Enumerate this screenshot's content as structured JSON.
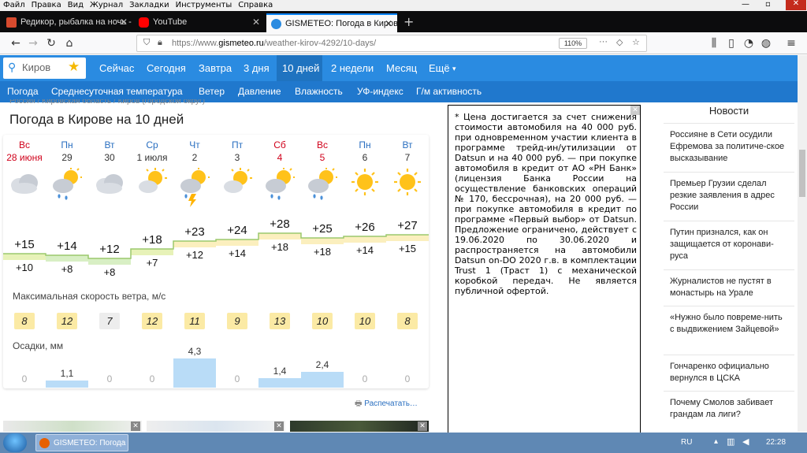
{
  "menu": [
    "Файл",
    "Правка",
    "Вид",
    "Журнал",
    "Закладки",
    "Инструменты",
    "Справка"
  ],
  "tabs": [
    {
      "title": "Редикор, рыбалка на ночь - Р",
      "color": "#d64a2e"
    },
    {
      "title": "YouTube",
      "color": "#ff0000"
    },
    {
      "title": "GISMETEO: Погода в Кирове н",
      "color": "#2a8be1"
    }
  ],
  "url_prefix": "https://www.",
  "url_domain": "gismeteo.ru",
  "url_path": "/weather-kirov-4292/10-days/",
  "zoom": "110%",
  "search_value": "Киров",
  "site_nav": [
    "Сейчас",
    "Сегодня",
    "Завтра",
    "3 дня",
    "10 дней",
    "2 недели",
    "Месяц",
    "Ещё"
  ],
  "sub_nav": [
    "Погода",
    "Среднесуточная температура",
    "Ветер",
    "Давление",
    "Влажность",
    "УФ-индекс",
    "Г/м активность"
  ],
  "breadcrumb": "Россия  /  Кировская область  /  Киров (городской округ)",
  "page_title": "Погода в Кирове на 10 дней",
  "days": [
    {
      "name": "Вс",
      "date": "28 июня",
      "weekend": true,
      "icon": "cloud",
      "tmax": "+15",
      "tmin": "+10",
      "wind": "8",
      "precip": "0",
      "precip_value": 0
    },
    {
      "name": "Пн",
      "date": "29",
      "weekend": false,
      "icon": "sun-cloud-rain",
      "tmax": "+14",
      "tmin": "+8",
      "wind": "12",
      "precip": "1,1",
      "precip_value": 1.1
    },
    {
      "name": "Вт",
      "date": "30",
      "weekend": false,
      "icon": "cloud",
      "tmax": "+12",
      "tmin": "+8",
      "wind": "7",
      "precip": "0",
      "precip_value": 0
    },
    {
      "name": "Ср",
      "date": "1 июля",
      "weekend": false,
      "icon": "sun-cloud",
      "tmax": "+18",
      "tmin": "+7",
      "wind": "12",
      "precip": "0",
      "precip_value": 0
    },
    {
      "name": "Чт",
      "date": "2",
      "weekend": false,
      "icon": "sun-cloud-storm",
      "tmax": "+23",
      "tmin": "+12",
      "wind": "11",
      "precip": "4,3",
      "precip_value": 4.3
    },
    {
      "name": "Пт",
      "date": "3",
      "weekend": false,
      "icon": "sun-cloud",
      "tmax": "+24",
      "tmin": "+14",
      "wind": "9",
      "precip": "0",
      "precip_value": 0
    },
    {
      "name": "Сб",
      "date": "4",
      "weekend": true,
      "icon": "sun-cloud-rain",
      "tmax": "+28",
      "tmin": "+18",
      "wind": "13",
      "precip": "1,4",
      "precip_value": 1.4
    },
    {
      "name": "Вс",
      "date": "5",
      "weekend": true,
      "icon": "sun-cloud-rain",
      "tmax": "+25",
      "tmin": "+18",
      "wind": "10",
      "precip": "2,4",
      "precip_value": 2.4
    },
    {
      "name": "Пн",
      "date": "6",
      "weekend": false,
      "icon": "sun",
      "tmax": "+26",
      "tmin": "+14",
      "wind": "10",
      "precip": "0",
      "precip_value": 0
    },
    {
      "name": "Вт",
      "date": "7",
      "weekend": false,
      "icon": "sun",
      "tmax": "+27",
      "tmin": "+15",
      "wind": "8",
      "precip": "0",
      "precip_value": 0
    }
  ],
  "temp_max_values": [
    15,
    14,
    12,
    18,
    23,
    24,
    28,
    25,
    26,
    27
  ],
  "wind_label": "Максимальная скорость ветра, м/с",
  "precip_label": "Осадки, мм",
  "print_label": "Распечатать…",
  "ad_text": "*  Цена достигается за счет снижения стоимости автомобиля на 40 000 руб. при одновременном участии клиента в программе трейд-ин/утилизации от Datsun и на 40 000 руб. — при покупке автомобиля в кредит от АО «РН Банк» (лицензия Банка России на осуществление банковских операций № 170, бессрочная), на 20 000 руб. — при покупке автомобиля в кредит по программе «Первый выбор» от Datsun. Предложение ограничено, действует с 19.06.2020 по 30.06.2020 и распространяется на автомобили Datsun on-DO 2020 г.в. в комплектации Trust 1 (Траст 1) с механической коробкой передач. Не является публичной офертой.",
  "news_title": "Новости",
  "news": [
    "Россияне в Сети осудили Ефремова за политиче-ское высказывание",
    "Премьер Грузии сделал резкие заявления в адрес России",
    "Путин признался, как он защищается от коронави-руса",
    "Журналистов не пустят в монастырь на Урале",
    "«Нужно было повреме-нить с выдвижением Зайцевой»",
    "Гончаренко официально вернулся в ЦСКА",
    "Почему Смолов забивает грандам ла лиги?"
  ],
  "taskbar_item": "GISMETEO: Погода в...",
  "tray_lang": "RU",
  "tray_time": "22:28"
}
